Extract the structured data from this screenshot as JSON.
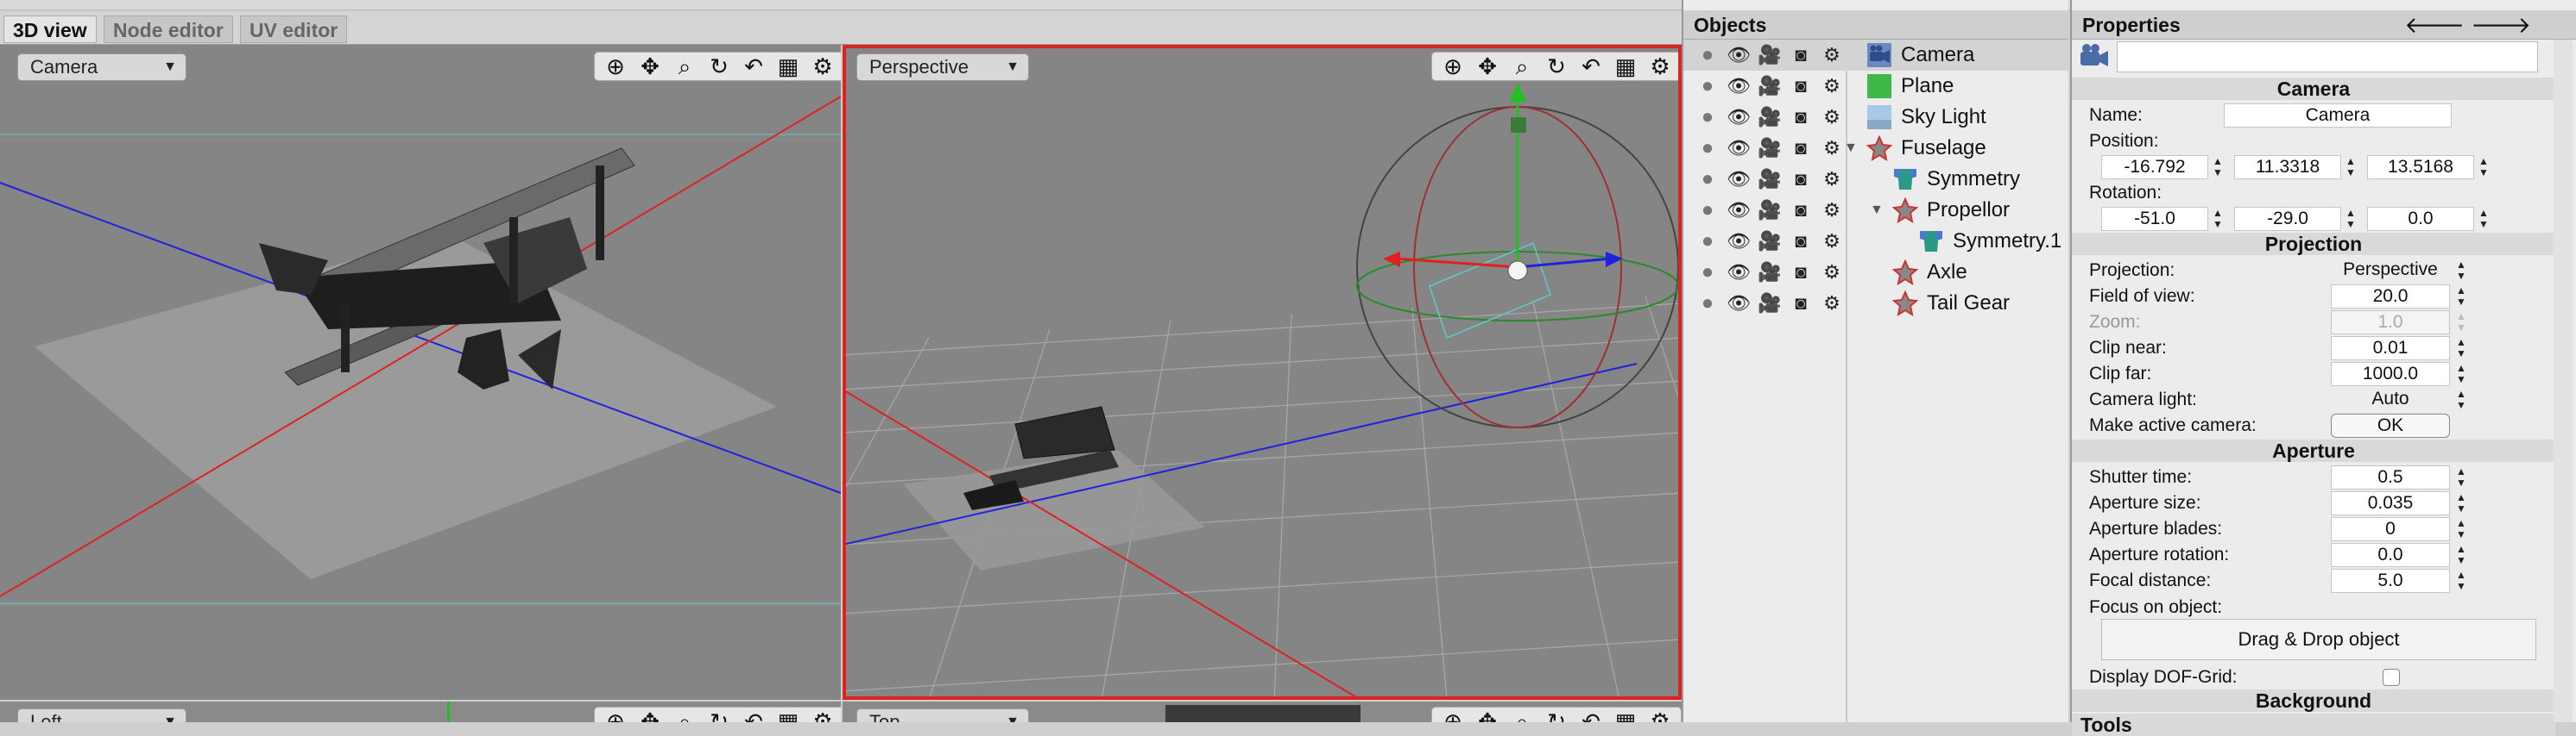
{
  "tabs": [
    "3D view",
    "Node editor",
    "UV editor"
  ],
  "viewports": {
    "top_left": {
      "mode": "Camera"
    },
    "top_right": {
      "mode": "Perspective"
    },
    "bottom_left": {
      "mode": "Left"
    },
    "bottom_right": {
      "mode": "Top"
    }
  },
  "toolbar_icons": [
    "move-view-icon",
    "pan-icon",
    "zoom-icon",
    "orbit-icon",
    "undo-view-icon",
    "layout-grid-icon",
    "settings-icon"
  ],
  "objects": {
    "title": "Objects",
    "items": [
      {
        "name": "Camera",
        "icon": "camera-icon",
        "indent": 0,
        "selected": true
      },
      {
        "name": "Plane",
        "icon": "plane-icon",
        "indent": 0
      },
      {
        "name": "Sky Light",
        "icon": "sky-light-icon",
        "indent": 0
      },
      {
        "name": "Fuselage",
        "icon": "mesh-icon",
        "indent": 0,
        "expanded": true
      },
      {
        "name": "Symmetry",
        "icon": "modifier-icon",
        "indent": 1
      },
      {
        "name": "Propellor",
        "icon": "mesh-icon",
        "indent": 1,
        "expanded": true
      },
      {
        "name": "Symmetry.1",
        "icon": "modifier-icon",
        "indent": 2
      },
      {
        "name": "Axle",
        "icon": "mesh-icon",
        "indent": 1
      },
      {
        "name": "Tail Gear",
        "icon": "mesh-icon",
        "indent": 1
      }
    ]
  },
  "properties": {
    "title": "Properties",
    "camera_section": "Camera",
    "name_label": "Name:",
    "name_value": "Camera",
    "position_label": "Position:",
    "position": [
      "-16.792",
      "11.3318",
      "13.5168"
    ],
    "rotation_label": "Rotation:",
    "rotation": [
      "-51.0",
      "-29.0",
      "0.0"
    ],
    "projection_section": "Projection",
    "projection_rows": [
      {
        "label": "Projection:",
        "value": "Perspective",
        "kind": "select"
      },
      {
        "label": "Field of view:",
        "value": "20.0",
        "kind": "spin"
      },
      {
        "label": "Zoom:",
        "value": "1.0",
        "kind": "spin",
        "disabled": true
      },
      {
        "label": "Clip near:",
        "value": "0.01",
        "kind": "spin"
      },
      {
        "label": "Clip far:",
        "value": "1000.0",
        "kind": "spin"
      },
      {
        "label": "Camera light:",
        "value": "Auto",
        "kind": "select"
      },
      {
        "label": "Make active camera:",
        "value": "OK",
        "kind": "button"
      }
    ],
    "aperture_section": "Aperture",
    "aperture_rows": [
      {
        "label": "Shutter time:",
        "value": "0.5"
      },
      {
        "label": "Aperture size:",
        "value": "0.035"
      },
      {
        "label": "Aperture blades:",
        "value": "0"
      },
      {
        "label": "Aperture rotation:",
        "value": "0.0"
      },
      {
        "label": "Focal distance:",
        "value": "5.0"
      }
    ],
    "focus_label": "Focus on object:",
    "drop_label": "Drag & Drop object",
    "dof_label": "Display DOF-Grid:",
    "background_section": "Background",
    "tools_section": "Tools"
  },
  "colors": {
    "viewport_bg": "#858585",
    "active_border": "#dd2222",
    "x_axis": "#e02020",
    "z_axis": "#2020e0",
    "y_axis": "#20c020"
  }
}
